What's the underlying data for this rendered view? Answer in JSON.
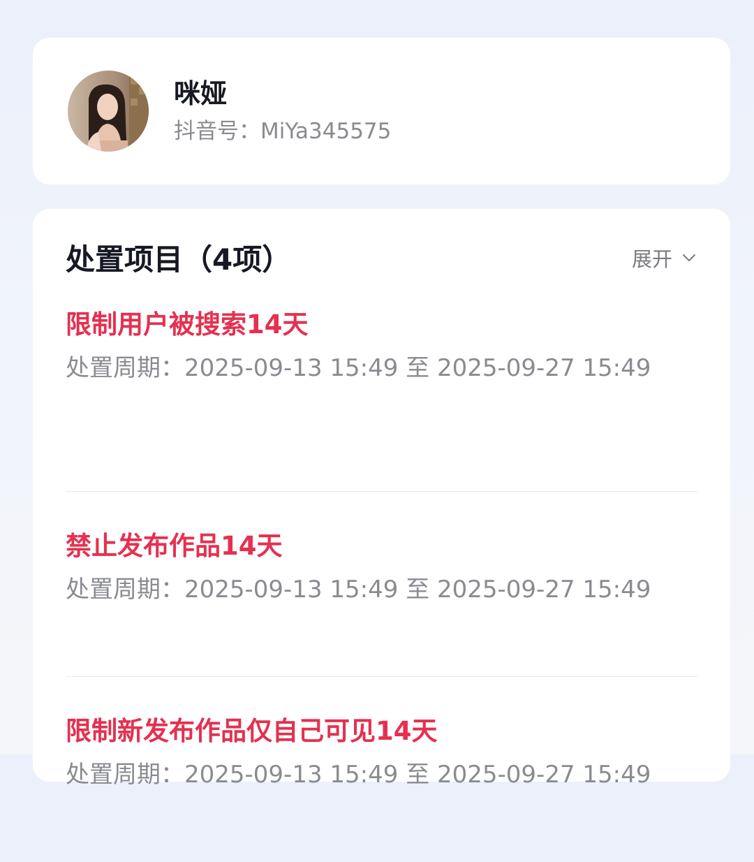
{
  "profile": {
    "name": "咪娅",
    "id_label": "抖音号：",
    "id_value": "MiYa345575",
    "avatar_icon": "user-avatar-photo"
  },
  "penalties": {
    "title": "处置项目（4项）",
    "expand_label": "展开",
    "expand_icon": "chevron-down-icon",
    "items": [
      {
        "title": "限制用户被搜索14天",
        "period_label": "处置周期：",
        "period": "2025-09-13 15:49 至 2025-09-27 15:49"
      },
      {
        "title": "禁止发布作品14天",
        "period_label": "处置周期：",
        "period": "2025-09-13 15:49 至 2025-09-27 15:49"
      },
      {
        "title": "限制新发布作品仅自己可见14天",
        "period_label": "处置周期：",
        "period": "2025-09-13 15:49 至 2025-09-27 15:49"
      }
    ]
  },
  "colors": {
    "accent_red": "#e5304f",
    "text_primary": "#161823",
    "text_secondary": "#8a8b91",
    "background": "#ebf0fb"
  }
}
